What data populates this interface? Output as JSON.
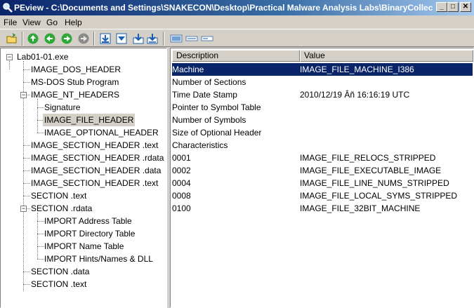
{
  "window": {
    "title": "PEview - C:\\Documents and Settings\\SNAKECON\\Desktop\\Practical Malware Analysis Labs\\BinaryCollecti...",
    "min_glyph": "_",
    "max_glyph": "□",
    "close_glyph": "✕"
  },
  "menu": [
    "File",
    "View",
    "Go",
    "Help"
  ],
  "toolbar": {
    "icons": [
      "open-folder-icon",
      "go-back-icon",
      "go-forward-icon",
      "go-up-icon",
      "go-disabled-icon",
      "download-icon",
      "down-arrow-icon",
      "save-down-icon",
      "save-all-icon",
      "view-detail-icon",
      "view-list-icon",
      "view-small-icon"
    ]
  },
  "tree": {
    "nodes": [
      {
        "label": "Lab01-01.exe",
        "level": 0,
        "expander": "−"
      },
      {
        "label": "IMAGE_DOS_HEADER",
        "level": 1
      },
      {
        "label": "MS-DOS Stub Program",
        "level": 1
      },
      {
        "label": "IMAGE_NT_HEADERS",
        "level": 1,
        "expander": "−"
      },
      {
        "label": "Signature",
        "level": 2
      },
      {
        "label": "IMAGE_FILE_HEADER",
        "level": 2,
        "selected": true
      },
      {
        "label": "IMAGE_OPTIONAL_HEADER",
        "level": 2
      },
      {
        "label": "IMAGE_SECTION_HEADER .text",
        "level": 1
      },
      {
        "label": "IMAGE_SECTION_HEADER .rdata",
        "level": 1
      },
      {
        "label": "IMAGE_SECTION_HEADER .data",
        "level": 1
      },
      {
        "label": "IMAGE_SECTION_HEADER .text",
        "level": 1
      },
      {
        "label": "SECTION .text",
        "level": 1
      },
      {
        "label": "SECTION .rdata",
        "level": 1,
        "expander": "−"
      },
      {
        "label": "IMPORT Address Table",
        "level": 2
      },
      {
        "label": "IMPORT Directory Table",
        "level": 2
      },
      {
        "label": "IMPORT Name Table",
        "level": 2
      },
      {
        "label": "IMPORT Hints/Names & DLL",
        "level": 2
      },
      {
        "label": "SECTION .data",
        "level": 1
      },
      {
        "label": "SECTION .text",
        "level": 1
      }
    ]
  },
  "list": {
    "columns": [
      "Description",
      "Value"
    ],
    "rows": [
      {
        "desc": "Machine",
        "value": "IMAGE_FILE_MACHINE_I386",
        "selected": true
      },
      {
        "desc": "Number of Sections",
        "value": ""
      },
      {
        "desc": "Time Date Stamp",
        "value": "2010/12/19 Âñ 16:16:19 UTC"
      },
      {
        "desc": "Pointer to Symbol Table",
        "value": ""
      },
      {
        "desc": "Number of Symbols",
        "value": ""
      },
      {
        "desc": "Size of Optional Header",
        "value": ""
      },
      {
        "desc": "Characteristics",
        "value": ""
      },
      {
        "desc": "0001",
        "value": "IMAGE_FILE_RELOCS_STRIPPED"
      },
      {
        "desc": "0002",
        "value": "IMAGE_FILE_EXECUTABLE_IMAGE"
      },
      {
        "desc": "0004",
        "value": "IMAGE_FILE_LINE_NUMS_STRIPPED"
      },
      {
        "desc": "0008",
        "value": "IMAGE_FILE_LOCAL_SYMS_STRIPPED"
      },
      {
        "desc": "0100",
        "value": "IMAGE_FILE_32BIT_MACHINE"
      }
    ]
  },
  "colors": {
    "titlebar": "#0a246a",
    "selection": "#0a246a",
    "face": "#d4d0c8"
  }
}
